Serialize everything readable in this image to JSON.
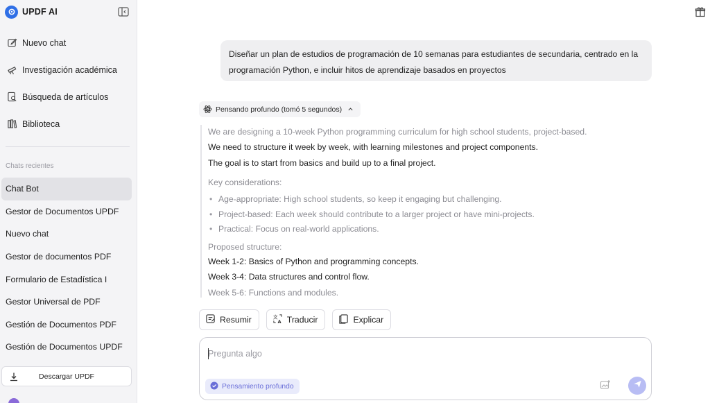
{
  "app": {
    "title": "UPDF AI"
  },
  "sidebar": {
    "nav": [
      {
        "label": "Nuevo chat",
        "icon": "edit-icon"
      },
      {
        "label": "Investigación académica",
        "icon": "telescope-icon"
      },
      {
        "label": "Búsqueda de artículos",
        "icon": "search-document-icon"
      },
      {
        "label": "Biblioteca",
        "icon": "library-icon"
      }
    ],
    "recent_label": "Chats recientes",
    "recent": [
      {
        "label": "Chat Bot",
        "active": true
      },
      {
        "label": "Gestor de Documentos UPDF"
      },
      {
        "label": "Nuevo chat"
      },
      {
        "label": "Gestor de documentos PDF"
      },
      {
        "label": "Formulario de Estadística I"
      },
      {
        "label": "Gestor Universal de PDF"
      },
      {
        "label": "Gestión de Documentos PDF"
      },
      {
        "label": "Gestión de Documentos UPDF"
      }
    ],
    "download_label": "Descargar UPDF"
  },
  "chat": {
    "user_message": "Diseñar un plan de estudios de programación de 10 semanas para estudiantes de secundaria, centrado en la programación Python, e incluir hitos de aprendizaje basados en proyectos",
    "thinking_label": "Pensando profundo (tomó 5 segundos)",
    "thinking_lines": [
      "We are designing a 10-week Python programming curriculum for high school students, project-based.",
      "We need to structure it week by week, with learning milestones and project components.",
      "The goal is to start from basics and build up to a final project.",
      "Key considerations:",
      "Age-appropriate: High school students, so keep it engaging but challenging.",
      "Project-based: Each week should contribute to a larger project or have mini-projects.",
      "Practical: Focus on real-world applications.",
      "Proposed structure:",
      "Week 1-2: Basics of Python and programming concepts.",
      "Week 3-4: Data structures and control flow.",
      "Week 5-6: Functions and modules."
    ]
  },
  "actions": {
    "summarize": "Resumir",
    "translate": "Traducir",
    "explain": "Explicar"
  },
  "composer": {
    "placeholder": "Pregunta algo",
    "deep_thinking": "Pensamiento profundo"
  },
  "colors": {
    "accent": "#2f6fe6",
    "send_button": "#b8bdf4",
    "deep_chip_bg": "#e9ebfb",
    "deep_chip_text": "#6a6fd8"
  }
}
